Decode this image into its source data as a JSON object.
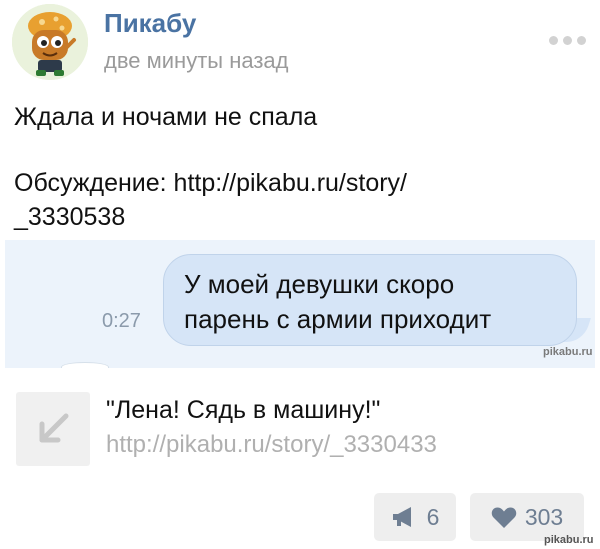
{
  "post": {
    "author": "Пикабу",
    "time": "две минуты назад",
    "text_line1": "Ждала и ночами не спала",
    "text_line2": "Обсуждение: http://pikabu.ru/story/",
    "text_line3": "_3330538"
  },
  "attachment": {
    "time": "0:27",
    "message_line1": "У моей девушки скоро",
    "message_line2": "парень с армии приходит",
    "watermark": "pikabu.ru"
  },
  "link": {
    "title": "\"Лена! Сядь в машину!\"",
    "url": "http://pikabu.ru/story/_3330433",
    "icon": "arrow-up-left-icon"
  },
  "actions": {
    "share_count": "6",
    "like_count": "303"
  },
  "watermark": "pikabu.ru",
  "colors": {
    "author": "#4a73a3",
    "bubble": "#d6e5f7",
    "chat_bg": "#ecf3fb",
    "button_bg": "#eeeeee",
    "button_text": "#6e7e92"
  }
}
